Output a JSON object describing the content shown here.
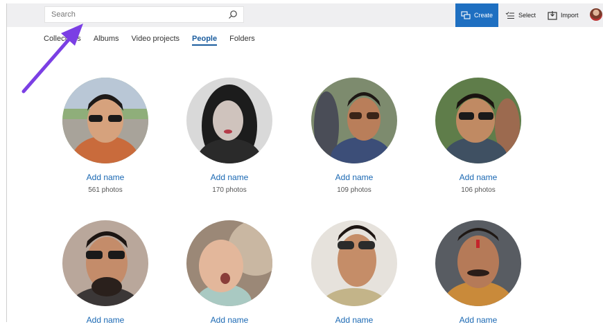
{
  "toolbar": {
    "search_placeholder": "Search",
    "create_label": "Create",
    "select_label": "Select",
    "import_label": "Import"
  },
  "nav": {
    "tabs": [
      {
        "label": "Collections"
      },
      {
        "label": "Albums"
      },
      {
        "label": "Video projects"
      },
      {
        "label": "People"
      },
      {
        "label": "Folders"
      }
    ],
    "active_tab": "People"
  },
  "people": [
    {
      "name_label": "Add name",
      "count": "561 photos"
    },
    {
      "name_label": "Add name",
      "count": "170 photos"
    },
    {
      "name_label": "Add name",
      "count": "109 photos"
    },
    {
      "name_label": "Add name",
      "count": "106 photos"
    },
    {
      "name_label": "Add name",
      "count": ""
    },
    {
      "name_label": "Add name",
      "count": ""
    },
    {
      "name_label": "Add name",
      "count": ""
    },
    {
      "name_label": "Add name",
      "count": ""
    }
  ],
  "colors": {
    "accent": "#1e6fc1",
    "link": "#1a68b3",
    "annotation_arrow": "#7b3fe4"
  }
}
